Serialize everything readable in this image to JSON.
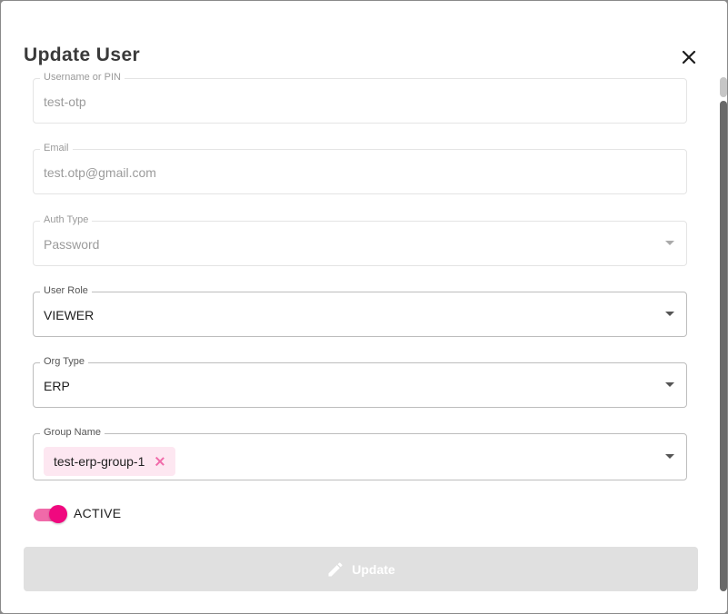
{
  "dialog": {
    "title": "Update User"
  },
  "form": {
    "username": {
      "label": "Username or PIN",
      "value": "test-otp"
    },
    "email": {
      "label": "Email",
      "value": "test.otp@gmail.com"
    },
    "auth_type": {
      "label": "Auth Type",
      "value": "Password"
    },
    "user_role": {
      "label": "User Role",
      "value": "VIEWER"
    },
    "org_type": {
      "label": "Org Type",
      "value": "ERP"
    },
    "group_name": {
      "label": "Group Name",
      "chips": [
        "test-erp-group-1"
      ]
    },
    "active": {
      "label": "ACTIVE",
      "checked": true
    }
  },
  "actions": {
    "update_label": "Update"
  },
  "icons": {
    "close": "close-icon",
    "edit": "pencil-icon",
    "chip_remove": "close-icon",
    "dropdown": "chevron-down-icon"
  },
  "colors": {
    "accent": "#f0087f",
    "accent_light": "#f06aa9",
    "chip_bg": "#fde7f1",
    "disabled_button": "#e0e0e0"
  }
}
